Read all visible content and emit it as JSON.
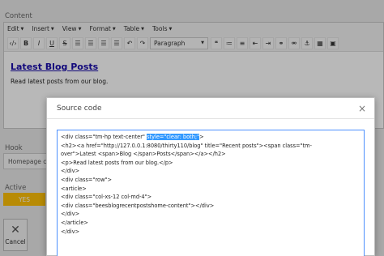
{
  "content_label": "Content",
  "menubar": [
    {
      "label": "Edit"
    },
    {
      "label": "Insert"
    },
    {
      "label": "View"
    },
    {
      "label": "Format"
    },
    {
      "label": "Table"
    },
    {
      "label": "Tools"
    }
  ],
  "toolbar": {
    "format_select": "Paragraph"
  },
  "editor": {
    "title": "Latest Blog Posts",
    "paragraph": "Read latest posts from our blog."
  },
  "hook_label": "Hook",
  "hook_value": "Homepage c",
  "active_label": "Active",
  "active_value": "YES",
  "cancel_label": "Cancel",
  "modal": {
    "title": "Source code",
    "code": {
      "line1_before": "<div class=\"tm-hp text-center\" ",
      "line1_highlight": "style=\"clear: both;\"",
      "line1_after": ">",
      "lines": [
        "<h2><a href=\"http://127.0.0.1:8080/thirty110/blog\" title=\"Recent posts\"><span class=\"tm-",
        "over\">Latest <span>Blog </span>Posts</span></a></h2>",
        "<p>Read latest posts from our blog.</p>",
        "</div>",
        "<div class=\"row\">",
        "<article>",
        "<div class=\"col-xs-12 col-md-4\">",
        "<div class=\"beesblogrecentpostshome-content\"></div>",
        "</div>",
        "</article>",
        "</div>"
      ]
    }
  }
}
